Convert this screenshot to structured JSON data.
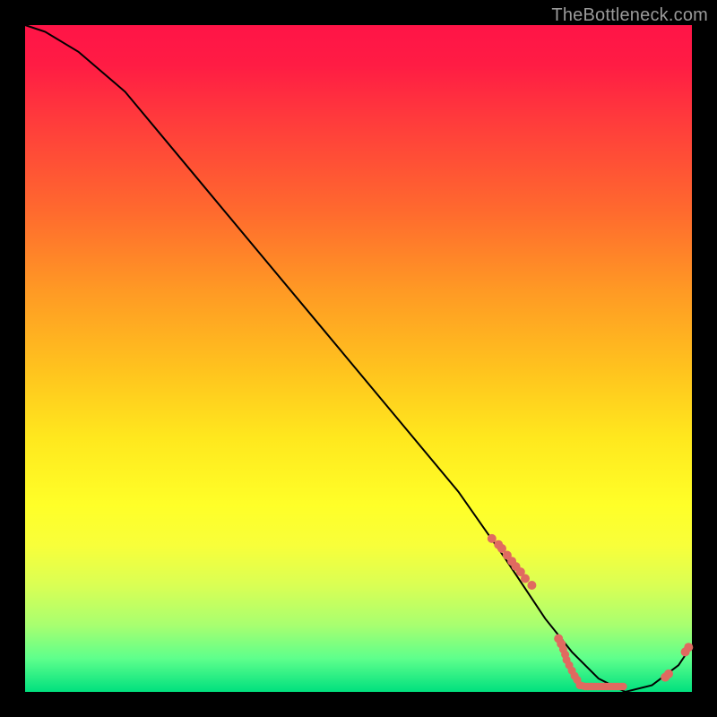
{
  "watermark": "TheBottleneck.com",
  "chart_data": {
    "type": "line",
    "title": "",
    "xlabel": "",
    "ylabel": "",
    "xlim": [
      0,
      100
    ],
    "ylim": [
      0,
      100
    ],
    "series": [
      {
        "name": "curve",
        "x": [
          0,
          3,
          8,
          15,
          25,
          35,
          45,
          55,
          65,
          72,
          78,
          82,
          86,
          90,
          94,
          98,
          100
        ],
        "y": [
          100,
          99,
          96,
          90,
          78,
          66,
          54,
          42,
          30,
          20,
          11,
          6,
          2,
          0,
          1,
          4,
          7
        ]
      }
    ],
    "scatter_points": {
      "name": "highlights",
      "color": "#e06a60",
      "x": [
        70,
        71,
        71.5,
        72.3,
        73,
        73.6,
        74.3,
        75,
        76,
        80,
        80.4,
        80.7,
        81,
        81.2,
        81.6,
        82,
        82.4,
        82.8,
        83.2,
        83.6,
        84,
        84.4,
        84.8,
        85.1,
        85.5,
        85.9,
        86.3,
        86.7,
        87.1,
        87.5,
        87.9,
        88.3,
        88.7,
        89,
        89.4,
        89.7,
        96,
        96.5,
        99,
        99.5
      ],
      "y": [
        23,
        22.1,
        21.5,
        20.5,
        19.6,
        18.8,
        18,
        17,
        16,
        8,
        7.2,
        6.4,
        5.6,
        4.8,
        4,
        3.2,
        2.4,
        1.8,
        1,
        0.9,
        0.8,
        0.8,
        0.8,
        0.8,
        0.8,
        0.8,
        0.8,
        0.8,
        0.8,
        0.8,
        0.8,
        0.8,
        0.8,
        0.8,
        0.8,
        0.8,
        2.2,
        2.7,
        6,
        6.7
      ],
      "r": [
        5,
        5,
        5,
        5,
        5,
        5,
        5,
        5,
        5,
        5,
        5,
        4.5,
        4.5,
        4.5,
        4.5,
        4.5,
        4.5,
        4.5,
        4.5,
        4.2,
        4.2,
        4.2,
        4.2,
        4.2,
        4.2,
        4.2,
        4.2,
        4.2,
        4.2,
        4.2,
        4.2,
        4.2,
        4.2,
        4.2,
        4.2,
        4.2,
        5,
        5,
        5,
        5
      ]
    }
  }
}
